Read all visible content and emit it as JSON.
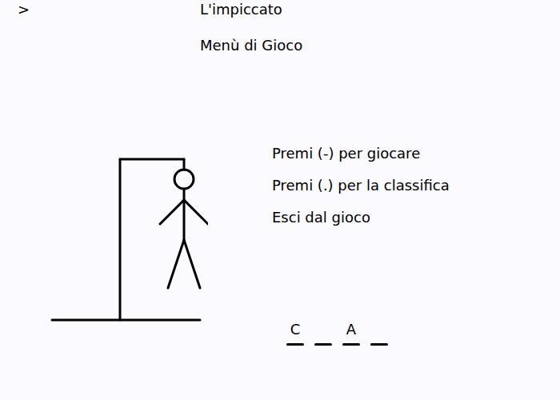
{
  "cursor": ">",
  "title": "L'impiccato",
  "subtitle": "Menù di Gioco",
  "hangman": {
    "level": 1
  },
  "menu": [
    {
      "label": "Premi (-) per giocare"
    },
    {
      "label": "Premi (.) per la classifica"
    },
    {
      "label": "Esci dal gioco"
    }
  ],
  "word": [
    {
      "letter": "C",
      "revealed": true
    },
    {
      "letter": "",
      "revealed": false
    },
    {
      "letter": "A",
      "revealed": true
    },
    {
      "letter": "",
      "revealed": false
    }
  ]
}
